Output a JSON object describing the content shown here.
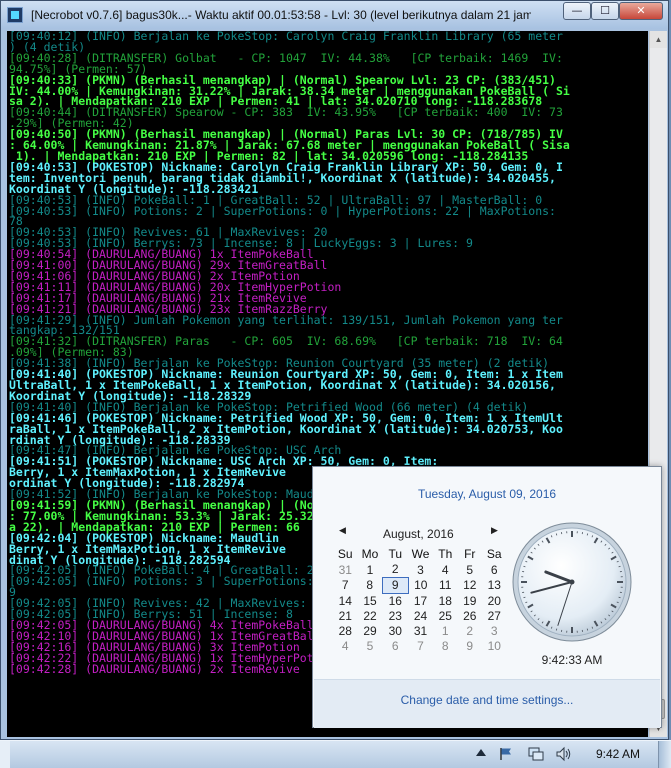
{
  "window": {
    "title": "[Necrobot v0.7.6] bagus30k...- Waktu aktif 00.01:53:58 - Lvl: 30 (level berikutnya dalam 21 jam ...",
    "minimize": "—",
    "maximize": "☐",
    "close": "✕"
  },
  "console_lines": [
    {
      "t": "[09:40:12] (INFO) Berjalan ke PokeStop: Carolyn Craig Franklin Library (65 meter",
      "k": "info"
    },
    {
      "t": ") (4 detik)",
      "k": "info"
    },
    {
      "t": "[09:40:28] (DITRANSFER) Golbat   - CP: 1047  IV: 44.38%   [CP terbaik: 1469  IV:",
      "k": "transfer"
    },
    {
      "t": "94.75%] (Permen: 57)",
      "k": "transfer"
    },
    {
      "t": "[09:40:33] (PKMN) (Berhasil menangkap) | (Normal) Spearow Lvl: 23 CP: (383/451)",
      "k": "pkmn"
    },
    {
      "t": "IV: 44.00% | Kemungkinan: 31.22% | Jarak: 38.34 meter | menggunakan PokeBall ( Si",
      "k": "pkmn"
    },
    {
      "t": "sa 2). | Mendapatkan: 210 EXP | Permen: 41 | lat: 34.020710 long: -118.283678",
      "k": "pkmn"
    },
    {
      "t": "[09:40:44] (DITRANSFER) Spearow - CP: 383  IV: 43.95%   [CP terbaik: 400  IV: 73",
      "k": "transfer"
    },
    {
      "t": ".29%] (Permen: 42)",
      "k": "transfer"
    },
    {
      "t": "[09:40:50] (PKMN) (Berhasil menangkap) | (Normal) Paras Lvl: 30 CP: (718/785) IV",
      "k": "pkmn"
    },
    {
      "t": ": 64.00% | Kemungkinan: 21.87% | Jarak: 67.68 meter | menggunakan PokeBall ( Sisa",
      "k": "pkmn"
    },
    {
      "t": " 1). | Mendapatkan: 210 EXP | Permen: 82 | lat: 34.020596 long: -118.284135",
      "k": "pkmn"
    },
    {
      "t": "[09:40:53] (POKESTOP) Nickname: Carolyn Craig Franklin Library XP: 50, Gem: 0, I",
      "k": "pokestop"
    },
    {
      "t": "tem: Inventori penuh, barang tidak diambil!, Koordinat X (latitude): 34.020455,",
      "k": "pokestop"
    },
    {
      "t": "Koordinat Y (longitude): -118.283421",
      "k": "pokestop"
    },
    {
      "t": "[09:40:53] (INFO) PokeBall: 1 | GreatBall: 52 | UltraBall: 97 | MasterBall: 0",
      "k": "info"
    },
    {
      "t": "[09:40:53] (INFO) Potions: 2 | SuperPotions: 0 | HyperPotions: 22 | MaxPotions:",
      "k": "info"
    },
    {
      "t": "78",
      "k": "info"
    },
    {
      "t": "[09:40:53] (INFO) Revives: 61 | MaxRevives: 20",
      "k": "info"
    },
    {
      "t": "[09:40:53] (INFO) Berrys: 73 | Incense: 8 | LuckyEggs: 3 | Lures: 9",
      "k": "info"
    },
    {
      "t": "[09:40:54] (DAURULANG/BUANG) 1x ItemPokeBall",
      "k": "daur"
    },
    {
      "t": "[09:41:00] (DAURULANG/BUANG) 29x ItemGreatBall",
      "k": "daur"
    },
    {
      "t": "[09:41:06] (DAURULANG/BUANG) 2x ItemPotion",
      "k": "daur"
    },
    {
      "t": "[09:41:11] (DAURULANG/BUANG) 20x ItemHyperPotion",
      "k": "daur"
    },
    {
      "t": "[09:41:17] (DAURULANG/BUANG) 21x ItemRevive",
      "k": "daur"
    },
    {
      "t": "[09:41:21] (DAURULANG/BUANG) 23x ItemRazzBerry",
      "k": "daur"
    },
    {
      "t": "[09:41:29] (INFO) Jumlah Pokemon yang terlihat: 139/151, Jumlah Pokemon yang ter",
      "k": "info"
    },
    {
      "t": "tangkap: 132/151",
      "k": "info"
    },
    {
      "t": "[09:41:32] (DITRANSFER) Paras   - CP: 605  IV: 68.69%   [CP terbaik: 718  IV: 64",
      "k": "transfer"
    },
    {
      "t": ".09%] (Permen: 83)",
      "k": "transfer"
    },
    {
      "t": "[09:41:38] (INFO) Berjalan ke PokeStop: Reunion Courtyard (35 meter) (2 detik)",
      "k": "info"
    },
    {
      "t": "[09:41:40] (POKESTOP) Nickname: Reunion Courtyard XP: 50, Gem: 0, Item: 1 x Item",
      "k": "pokestop"
    },
    {
      "t": "UltraBall, 1 x ItemPokeBall, 1 x ItemPotion, Koordinat X (latitude): 34.020156,",
      "k": "pokestop"
    },
    {
      "t": "Koordinat Y (longitude): -118.28329",
      "k": "pokestop"
    },
    {
      "t": "[09:41:40] (INFO) Berjalan ke PokeStop: Petrified Wood (66 meter) (4 detik)",
      "k": "info"
    },
    {
      "t": "[09:41:46] (POKESTOP) Nickname: Petrified Wood XP: 50, Gem: 0, Item: 1 x ItemUlt",
      "k": "pokestop"
    },
    {
      "t": "raBall, 1 x ItemPokeBall, 2 x ItemPotion, Koordinat X (latitude): 34.020753, Koo",
      "k": "pokestop"
    },
    {
      "t": "rdinat Y (longitude): -118.28339",
      "k": "pokestop"
    },
    {
      "t": "[09:41:47] (INFO) Berjalan ke PokeStop: USC Arch",
      "k": "info"
    },
    {
      "t": "[09:41:51] (POKESTOP) Nickname: USC Arch XP: 50, Gem: 0, Item:",
      "k": "pokestop"
    },
    {
      "t": "Berry, 1 x ItemMaxPotion, 1 x ItemRevive",
      "k": "pokestop"
    },
    {
      "t": "ordinat Y (longitude): -118.282974",
      "k": "pokestop"
    },
    {
      "t": "[09:41:52] (INFO) Berjalan ke PokeStop: Maudlin",
      "k": "info"
    },
    {
      "t": "[09:41:59] (PKMN) (Berhasil menangkap) | (Normal)",
      "k": "pkmn"
    },
    {
      "t": ": 77.00% | Kemungkinan: 53.3% | Jarak: 25.32",
      "k": "pkmn"
    },
    {
      "t": "a 22). | Mendapatkan: 210 EXP | Permen: 66",
      "k": "pkmn"
    },
    {
      "t": "[09:42:04] (POKESTOP) Nickname: Maudlin",
      "k": "pokestop"
    },
    {
      "t": "Berry, 1 x ItemMaxPotion, 1 x ItemRevive",
      "k": "pokestop"
    },
    {
      "t": "dinat Y (longitude): -118.282594",
      "k": "pokestop"
    },
    {
      "t": "[09:42:05] (INFO) PokeBall: 4 | GreatBall: 23",
      "k": "info"
    },
    {
      "t": "[09:42:05] (INFO) Potions: 3 | SuperPotions: 0",
      "k": "info"
    },
    {
      "t": "9",
      "k": "info"
    },
    {
      "t": "[09:42:05] (INFO) Revives: 42 | MaxRevives: 21",
      "k": "info"
    },
    {
      "t": "[09:42:05] (INFO) Berrys: 51 | Incense: 8",
      "k": "info"
    },
    {
      "t": "[09:42:05] (DAURULANG/BUANG) 4x ItemPokeBall",
      "k": "daur"
    },
    {
      "t": "[09:42:10] (DAURULANG/BUANG) 1x ItemGreatBall",
      "k": "daur"
    },
    {
      "t": "[09:42:16] (DAURULANG/BUANG) 3x ItemPotion",
      "k": "daur"
    },
    {
      "t": "[09:42:22] (DAURULANG/BUANG) 1x ItemHyperPotion",
      "k": "daur"
    },
    {
      "t": "[09:42:28] (DAURULANG/BUANG) 2x ItemRevive",
      "k": "daur"
    }
  ],
  "clock_flyout": {
    "long_date": "Tuesday, August 09, 2016",
    "month_label": "August, 2016",
    "prev": "◀",
    "next": "▶",
    "weekdays": [
      "Su",
      "Mo",
      "Tu",
      "We",
      "Th",
      "Fr",
      "Sa"
    ],
    "weeks": [
      [
        [
          "31",
          1
        ],
        [
          "1",
          0
        ],
        [
          "2",
          0
        ],
        [
          "3",
          0
        ],
        [
          "4",
          0
        ],
        [
          "5",
          0
        ],
        [
          "6",
          0
        ]
      ],
      [
        [
          "7",
          0
        ],
        [
          "8",
          0
        ],
        [
          "9",
          2
        ],
        [
          "10",
          0
        ],
        [
          "11",
          0
        ],
        [
          "12",
          0
        ],
        [
          "13",
          0
        ]
      ],
      [
        [
          "14",
          0
        ],
        [
          "15",
          0
        ],
        [
          "16",
          0
        ],
        [
          "17",
          0
        ],
        [
          "18",
          0
        ],
        [
          "19",
          0
        ],
        [
          "20",
          0
        ]
      ],
      [
        [
          "21",
          0
        ],
        [
          "22",
          0
        ],
        [
          "23",
          0
        ],
        [
          "24",
          0
        ],
        [
          "25",
          0
        ],
        [
          "26",
          0
        ],
        [
          "27",
          0
        ]
      ],
      [
        [
          "28",
          0
        ],
        [
          "29",
          0
        ],
        [
          "30",
          0
        ],
        [
          "31",
          0
        ],
        [
          "1",
          1
        ],
        [
          "2",
          1
        ],
        [
          "3",
          1
        ]
      ],
      [
        [
          "4",
          1
        ],
        [
          "5",
          1
        ],
        [
          "6",
          1
        ],
        [
          "7",
          1
        ],
        [
          "8",
          1
        ],
        [
          "9",
          1
        ],
        [
          "10",
          1
        ]
      ]
    ],
    "time_label": "9:42:33 AM",
    "clock_hands": {
      "hour": 9,
      "minute": 42,
      "second": 33
    },
    "settings_link": "Change date and time settings..."
  },
  "taskbar": {
    "time": "9:42 AM",
    "icons": [
      "show-hidden-icons-icon",
      "action-center-flag-icon",
      "network-icon",
      "volume-icon"
    ]
  },
  "colors": {
    "info": "#138a8a",
    "transfer": "#22a33a",
    "pkmn": "#45ff45",
    "pokestop": "#5ff2ff",
    "daur": "#c41fc4",
    "link": "#2a5da9"
  }
}
